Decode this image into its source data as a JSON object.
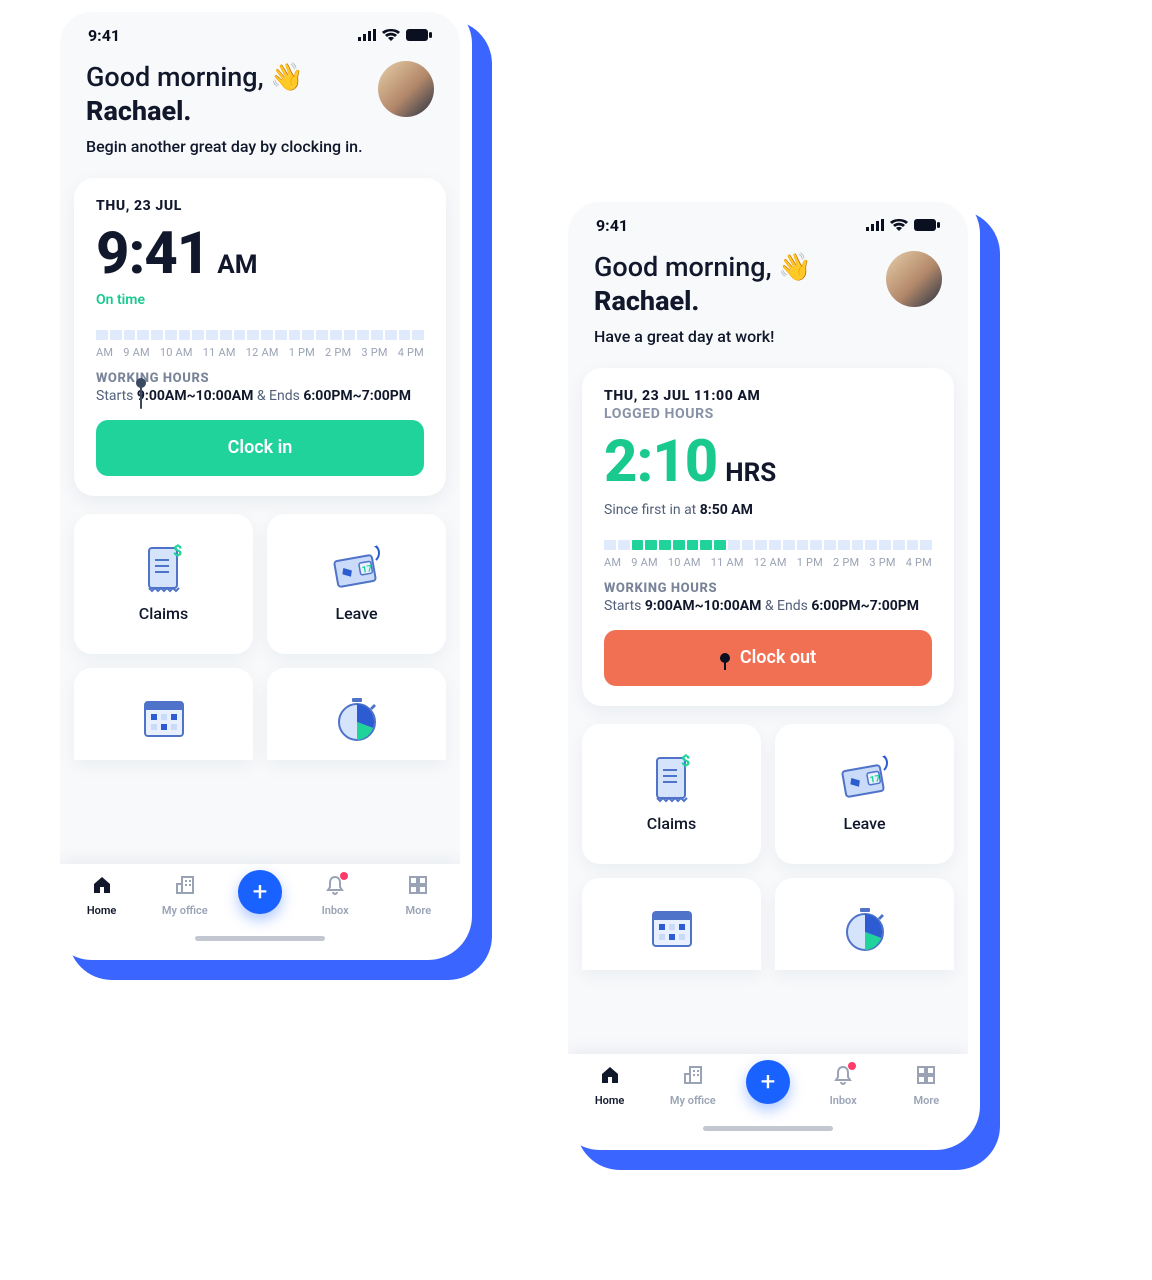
{
  "status": {
    "time": "9:41"
  },
  "greeting": {
    "hello": "Good morning,",
    "name": "Rachael.",
    "wave": "👋",
    "sub_a": "Begin another great day by clocking in.",
    "sub_b": "Have a great day at work!"
  },
  "cardA": {
    "date": "THU, 23 JUL",
    "time_num": "9:41",
    "time_suffix": "AM",
    "status": "On time",
    "wh_title": "WORKING HOURS",
    "wh_pre": "Starts ",
    "wh_start": "9:00AM~10:00AM",
    "wh_mid": " & Ends ",
    "wh_end": "6:00PM~7:00PM",
    "btn": "Clock in",
    "ticks": [
      "AM",
      "9 AM",
      "10 AM",
      "11 AM",
      "12 AM",
      "1 PM",
      "2 PM",
      "3 PM",
      "4 PM"
    ]
  },
  "cardB": {
    "date": "THU, 23 JUL 11:00 AM",
    "sub": "LOGGED HOURS",
    "time_num": "2:10",
    "time_suffix": "HRS",
    "since_pre": "Since first in at ",
    "since_time": "8:50 AM",
    "wh_title": "WORKING HOURS",
    "wh_pre": "Starts ",
    "wh_start": "9:00AM~10:00AM",
    "wh_mid": " & Ends ",
    "wh_end": "6:00PM~7:00PM",
    "btn": "Clock out",
    "ticks": [
      "AM",
      "9 AM",
      "10 AM",
      "11 AM",
      "12 AM",
      "1 PM",
      "2 PM",
      "3 PM",
      "4 PM"
    ]
  },
  "tiles": {
    "claims": "Claims",
    "leave": "Leave"
  },
  "tabs": {
    "home": "Home",
    "office": "My office",
    "inbox": "Inbox",
    "more": "More"
  }
}
